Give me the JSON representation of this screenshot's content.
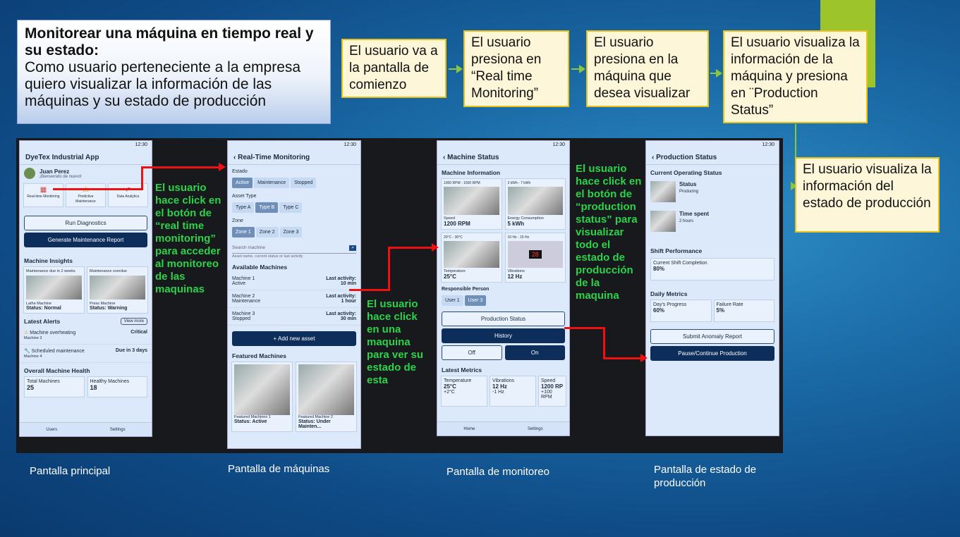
{
  "story": {
    "title": "Monitorear una máquina en tiempo real y su estado:",
    "body": "Como usuario perteneciente a la empresa quiero visualizar la información de las máquinas y su estado de producción"
  },
  "steps": [
    "El usuario va a la pantalla de comienzo",
    "El usuario presiona en “Real time Monitoring”",
    "El usuario presiona en la máquina que desea visualizar",
    "El usuario visualiza la información de la máquina y presiona en ¨Production Status”",
    "El usuario visualiza la información del estado de producción"
  ],
  "status_time": "12:30",
  "screen1": {
    "app_title": "DyeTex Industrial App",
    "user": "Juan Perez",
    "welcome": "¡Bienvenido de nuevo!",
    "shortcuts": [
      "Real-time Monitoring",
      "Predictive Maintenance",
      "Data Analytics"
    ],
    "run_diag": "Run Diagnostics",
    "gen_report": "Generate Maintenance Report",
    "insights_title": "Machine Insights",
    "insight_tags": [
      "Maintenance due in 2 weeks",
      "Maintenance overdue"
    ],
    "insight_names": [
      "Lathe Machine",
      "Press Machine"
    ],
    "insight_status": [
      "Status: Normal",
      "Status: Warning"
    ],
    "alerts_title": "Latest Alerts",
    "view_more": "View more",
    "alerts": [
      {
        "t": "Machine overheating",
        "s": "Machine 3",
        "r": "Critical"
      },
      {
        "t": "Scheduled maintenance",
        "s": "Machine 4",
        "r": "Due in 3 days"
      }
    ],
    "health_title": "Overall Machine Health",
    "total_label": "Total Machines",
    "total": "25",
    "healthy_label": "Healthy Machines",
    "healthy": "18",
    "nav": [
      "Users",
      "Settings"
    ]
  },
  "screen2": {
    "title": "Real-Time Monitoring",
    "estado": "Estado",
    "estado_chips": [
      "Active",
      "Maintenance",
      "Stopped"
    ],
    "asset_type": "Asset Type",
    "asset_chips": [
      "Type A",
      "Type B",
      "Type C"
    ],
    "zone": "Zone",
    "zone_chips": [
      "Zone 1",
      "Zone 2",
      "Zone 3"
    ],
    "search_ph": "Search machine",
    "search_hint": "Asset name, current status or last activity",
    "available": "Available Machines",
    "machines": [
      {
        "n": "Machine 1",
        "s": "Active",
        "l": "Last activity:",
        "t": "10 min"
      },
      {
        "n": "Machine 2",
        "s": "Maintenance",
        "l": "Last activity:",
        "t": "1 hour"
      },
      {
        "n": "Machine 3",
        "s": "Stopped",
        "l": "Last activity:",
        "t": "30 min"
      }
    ],
    "add": "+ Add new asset",
    "featured": "Featured Machines",
    "feat": [
      {
        "n": "Featured Machines 1",
        "s": "Status: Active"
      },
      {
        "n": "Featured Machine 2",
        "s": "Status: Under Mainten..."
      }
    ]
  },
  "screen3": {
    "title": "Machine Status",
    "info": "Machine Information",
    "tiles": [
      {
        "tag": "1000 RPM - 1500 RPM",
        "l": "Speed",
        "v": "1200 RPM"
      },
      {
        "tag": "3 kWh - 7 kWh",
        "l": "Energy Consumption",
        "v": "5 kWh"
      },
      {
        "tag": "20°C - 30°C",
        "l": "Temperature",
        "v": "25°C"
      },
      {
        "tag": "10 Hz - 15 Hz",
        "l": "Vibrations",
        "v": "12 Hz"
      }
    ],
    "resp": "Responsible Person",
    "users": [
      "User 1",
      "User 3"
    ],
    "prod_btn": "Production Status",
    "history": "History",
    "off": "Off",
    "on": "On",
    "latest": "Latest Metrics",
    "metrics": [
      {
        "l": "Temperature",
        "v": "25°C",
        "d": "+2°C"
      },
      {
        "l": "Vibrations",
        "v": "12 Hz",
        "d": "-1 Hz"
      },
      {
        "l": "Speed",
        "v": "1200 RP",
        "d": "+100 RPM"
      }
    ],
    "nav": [
      "Home",
      "Settings"
    ],
    "display_value": "28"
  },
  "screen4": {
    "title": "Production Status",
    "current": "Current Operating Status",
    "items": [
      {
        "l": "Status",
        "v": "Producing"
      },
      {
        "l": "Time spent",
        "v": "2 hours"
      }
    ],
    "shift": "Shift Performance",
    "shift_label": "Current Shift Completion",
    "shift_val": "80%",
    "daily": "Daily Metrics",
    "daily_items": [
      {
        "l": "Day's Progress",
        "v": "60%"
      },
      {
        "l": "Failure Rate",
        "v": "5%"
      }
    ],
    "submit": "Submit Anomaly Report",
    "pause": "Pause/Continue Production"
  },
  "annotations": [
    "El usuario hace click en el botón de “real time monitoring” para acceder al monitoreo de las maquinas",
    "El usuario hace click en una maquina para ver su estado de esta",
    "El usuario hace click en el botón de “production status” para visualizar todo el estado de producción de la maquina"
  ],
  "captions": [
    "Pantalla principal",
    "Pantalla de máquinas",
    "Pantalla de monitoreo",
    "Pantalla de estado de producción"
  ]
}
